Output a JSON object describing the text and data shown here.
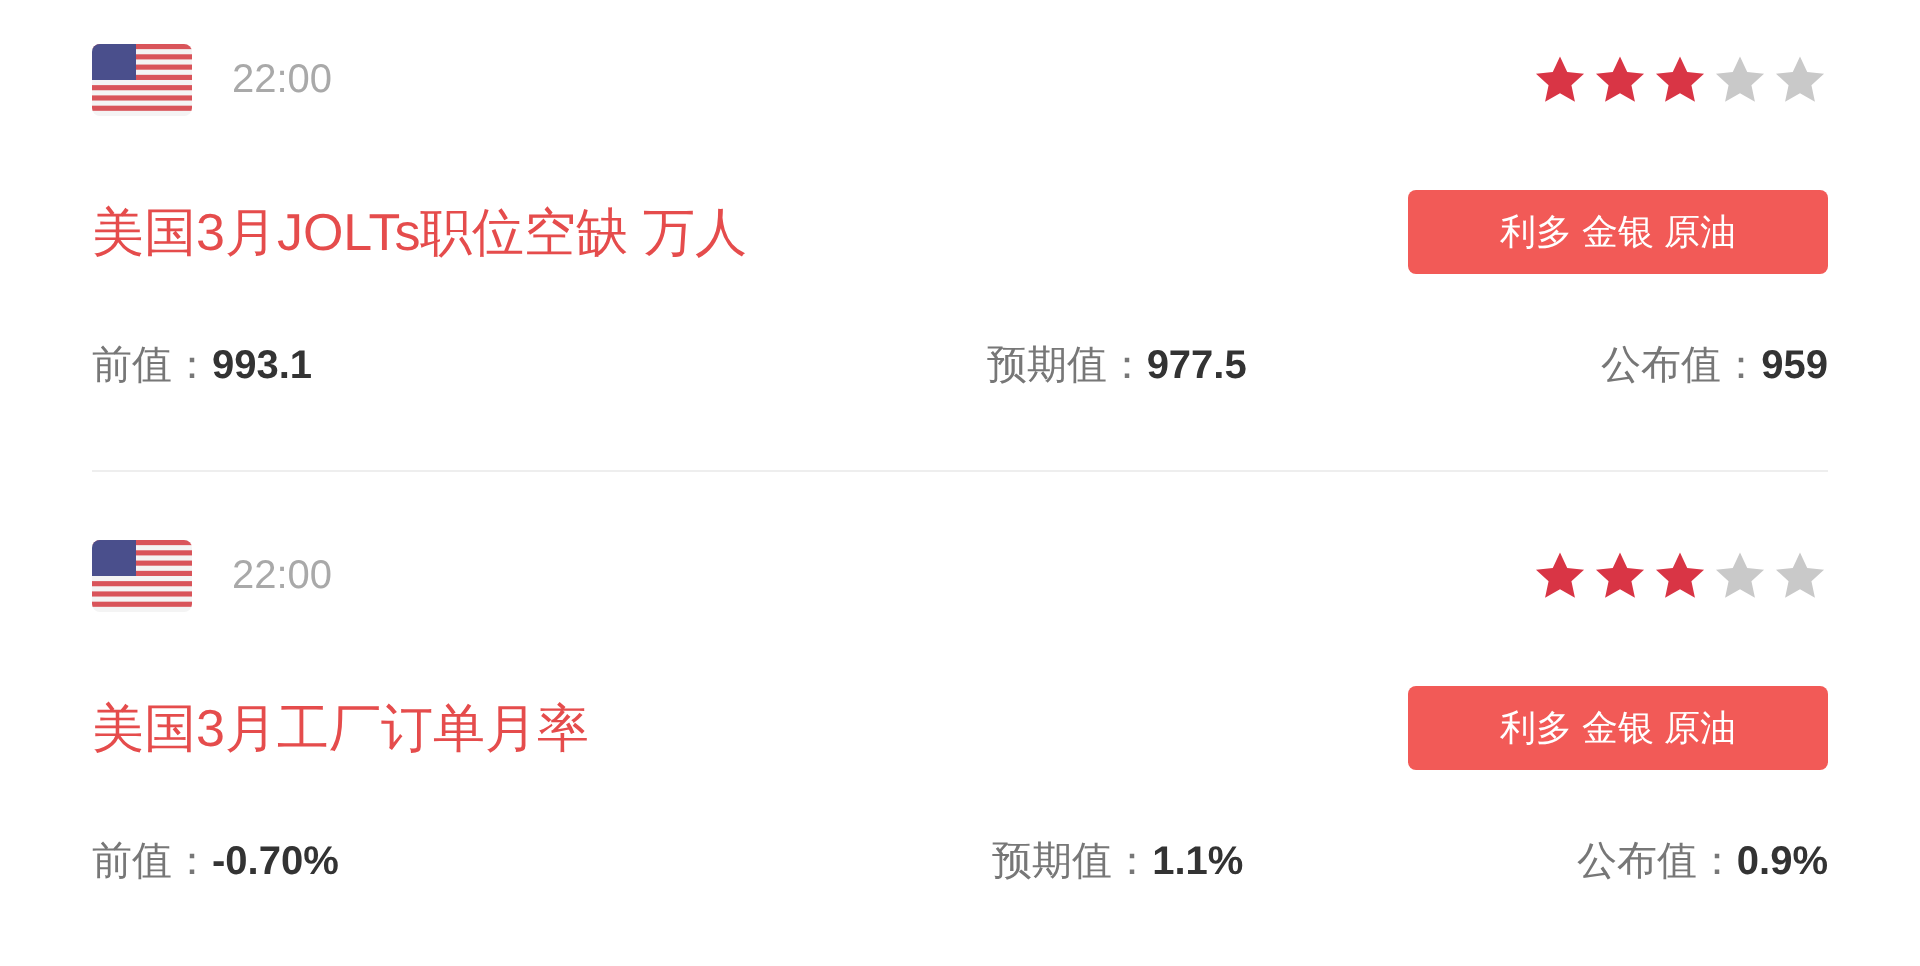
{
  "events": [
    {
      "time": "22:00",
      "stars": 3,
      "title": "美国3月JOLTs职位空缺 万人",
      "tag": "利多 金银 原油",
      "stats": [
        {
          "label": "前值：",
          "value": "993.1"
        },
        {
          "label": "预期值：",
          "value": "977.5"
        },
        {
          "label": "公布值：",
          "value": "959"
        }
      ]
    },
    {
      "time": "22:00",
      "stars": 3,
      "title": "美国3月工厂订单月率",
      "tag": "利多 金银 原油",
      "stats": [
        {
          "label": "前值：",
          "value": "-0.70%"
        },
        {
          "label": "预期值：",
          "value": "1.1%"
        },
        {
          "label": "公布值：",
          "value": "0.9%"
        }
      ]
    }
  ]
}
